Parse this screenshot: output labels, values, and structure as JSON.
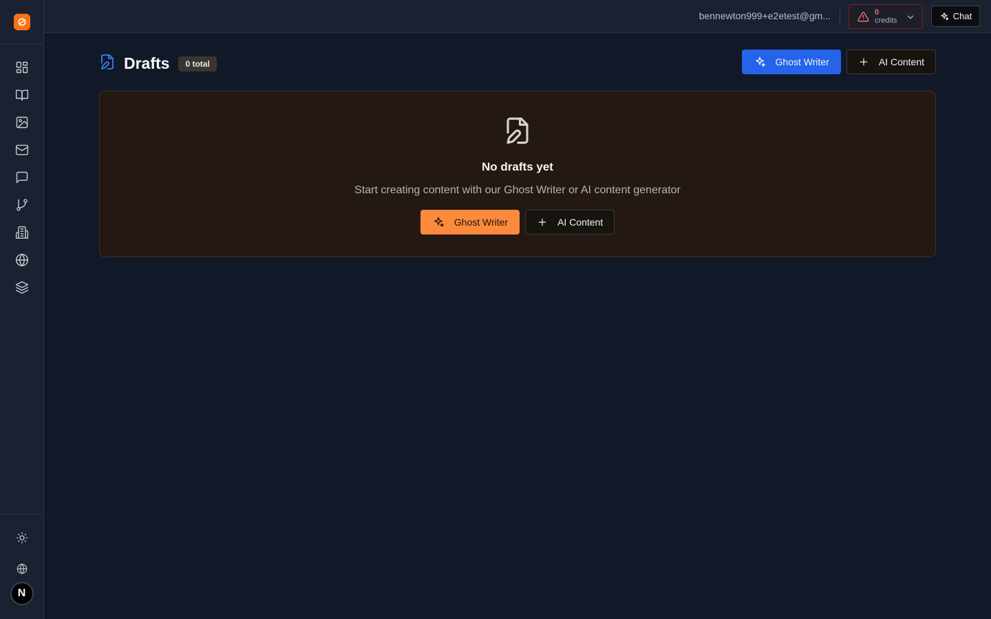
{
  "topbar": {
    "user_email": "bennewton999+e2etest@gm...",
    "credits": {
      "count": "0",
      "label": "credits"
    },
    "chat_label": "Chat"
  },
  "sidebar": {
    "items": [
      {
        "icon": "dashboard-icon"
      },
      {
        "icon": "book-icon"
      },
      {
        "icon": "image-icon"
      },
      {
        "icon": "mail-icon"
      },
      {
        "icon": "chat-bubble-icon"
      },
      {
        "icon": "git-branch-icon"
      },
      {
        "icon": "building-icon"
      },
      {
        "icon": "globe-icon"
      },
      {
        "icon": "layers-icon"
      }
    ],
    "bottom": [
      {
        "icon": "sun-icon"
      },
      {
        "icon": "globe-icon"
      },
      {
        "icon": "avatar",
        "text": "N"
      }
    ]
  },
  "page": {
    "title": "Drafts",
    "total_badge": "0 total",
    "ghost_writer_label": "Ghost Writer",
    "ai_content_label": "AI Content"
  },
  "empty_state": {
    "title": "No drafts yet",
    "subtitle": "Start creating content with our Ghost Writer or AI content generator",
    "ghost_writer_label": "Ghost Writer",
    "ai_content_label": "AI Content"
  },
  "colors": {
    "brand_orange": "#f97316",
    "primary_blue": "#2563eb",
    "danger_red": "#f87171",
    "background": "#111827"
  }
}
